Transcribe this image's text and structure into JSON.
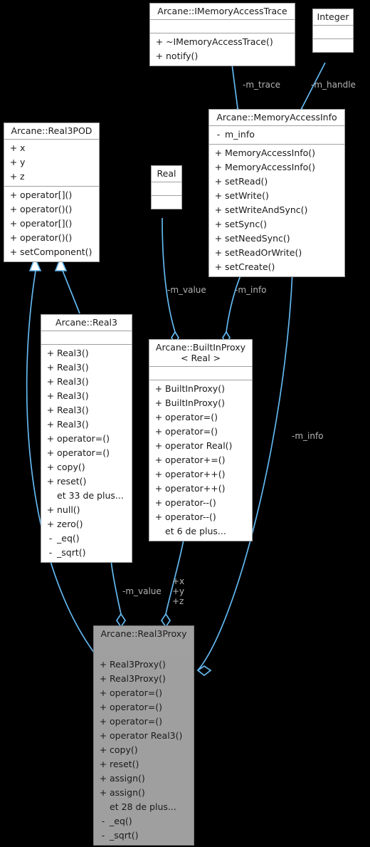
{
  "diagram": {
    "kind": "uml-class-diagram",
    "background": "#000000",
    "edge_color": "#63b8f0",
    "label_color": "#b4b4b4",
    "focus_fill": "#9f9f9f",
    "node_fill": "#ffffff",
    "node_border": "#a0a0a0"
  },
  "nodes": {
    "imemoryaccesstrace": {
      "title": "Arcane::IMemoryAccessTrace",
      "attributes": [],
      "operations": [
        {
          "vis": "+",
          "name": "~IMemoryAccessTrace()"
        },
        {
          "vis": "+",
          "name": "notify()"
        }
      ]
    },
    "integer": {
      "title": "Integer",
      "attributes": [],
      "operations": []
    },
    "memoryaccessinfo": {
      "title": "Arcane::MemoryAccessInfo",
      "attributes": [
        {
          "vis": "-",
          "name": "m_info"
        }
      ],
      "operations": [
        {
          "vis": "+",
          "name": "MemoryAccessInfo()"
        },
        {
          "vis": "+",
          "name": "MemoryAccessInfo()"
        },
        {
          "vis": "+",
          "name": "setRead()"
        },
        {
          "vis": "+",
          "name": "setWrite()"
        },
        {
          "vis": "+",
          "name": "setWriteAndSync()"
        },
        {
          "vis": "+",
          "name": "setSync()"
        },
        {
          "vis": "+",
          "name": "setNeedSync()"
        },
        {
          "vis": "+",
          "name": "setReadOrWrite()"
        },
        {
          "vis": "+",
          "name": "setCreate()"
        }
      ]
    },
    "real3pod": {
      "title": "Arcane::Real3POD",
      "attributes": [
        {
          "vis": "+",
          "name": "x"
        },
        {
          "vis": "+",
          "name": "y"
        },
        {
          "vis": "+",
          "name": "z"
        }
      ],
      "operations": [
        {
          "vis": "+",
          "name": "operator[]()"
        },
        {
          "vis": "+",
          "name": "operator()()"
        },
        {
          "vis": "+",
          "name": "operator[]()"
        },
        {
          "vis": "+",
          "name": "operator()()"
        },
        {
          "vis": "+",
          "name": "setComponent()"
        }
      ]
    },
    "real": {
      "title": "Real",
      "attributes": [],
      "operations": []
    },
    "real3": {
      "title": "Arcane::Real3",
      "attributes": [],
      "operations": [
        {
          "vis": "+",
          "name": "Real3()"
        },
        {
          "vis": "+",
          "name": "Real3()"
        },
        {
          "vis": "+",
          "name": "Real3()"
        },
        {
          "vis": "+",
          "name": "Real3()"
        },
        {
          "vis": "+",
          "name": "Real3()"
        },
        {
          "vis": "+",
          "name": "Real3()"
        },
        {
          "vis": "+",
          "name": "operator=()"
        },
        {
          "vis": "+",
          "name": "operator=()"
        },
        {
          "vis": "+",
          "name": "copy()"
        },
        {
          "vis": "+",
          "name": "reset()"
        },
        {
          "vis": "",
          "name": "et 33 de plus..."
        },
        {
          "vis": "+",
          "name": "null()"
        },
        {
          "vis": "+",
          "name": "zero()"
        },
        {
          "vis": "-",
          "name": "_eq()"
        },
        {
          "vis": "-",
          "name": "_sqrt()"
        }
      ]
    },
    "builtinproxy": {
      "title": "Arcane::BuiltInProxy\n< Real >",
      "attributes": [],
      "operations": [
        {
          "vis": "+",
          "name": "BuiltInProxy()"
        },
        {
          "vis": "+",
          "name": "BuiltInProxy()"
        },
        {
          "vis": "+",
          "name": "operator=()"
        },
        {
          "vis": "+",
          "name": "operator=()"
        },
        {
          "vis": "+",
          "name": "operator Real()"
        },
        {
          "vis": "+",
          "name": "operator+=()"
        },
        {
          "vis": "+",
          "name": "operator++()"
        },
        {
          "vis": "+",
          "name": "operator++()"
        },
        {
          "vis": "+",
          "name": "operator--()"
        },
        {
          "vis": "+",
          "name": "operator--()"
        },
        {
          "vis": "",
          "name": "et 6 de plus..."
        }
      ]
    },
    "real3proxy": {
      "title": "Arcane::Real3Proxy",
      "focus": true,
      "attributes": [],
      "operations": [
        {
          "vis": "+",
          "name": "Real3Proxy()"
        },
        {
          "vis": "+",
          "name": "Real3Proxy()"
        },
        {
          "vis": "+",
          "name": "operator=()"
        },
        {
          "vis": "+",
          "name": "operator=()"
        },
        {
          "vis": "+",
          "name": "operator=()"
        },
        {
          "vis": "+",
          "name": "operator Real3()"
        },
        {
          "vis": "+",
          "name": "copy()"
        },
        {
          "vis": "+",
          "name": "reset()"
        },
        {
          "vis": "+",
          "name": "assign()"
        },
        {
          "vis": "+",
          "name": "assign()"
        },
        {
          "vis": "",
          "name": "et 28 de plus..."
        },
        {
          "vis": "-",
          "name": "_eq()"
        },
        {
          "vis": "-",
          "name": "_sqrt()"
        }
      ]
    }
  },
  "edge_labels": {
    "m_trace": "-m_trace",
    "m_handle": "-m_handle",
    "m_value_top": "-m_value",
    "m_info_top": "-m_info",
    "m_info_right": "-m_info",
    "m_value_bottom": "-m_value",
    "xyz": "+x\n+y\n+z"
  }
}
